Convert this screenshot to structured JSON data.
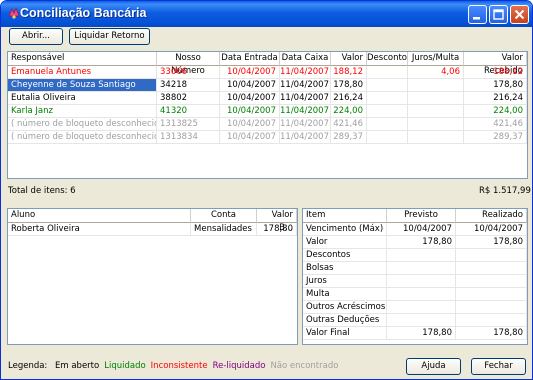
{
  "window": {
    "title": "Conciliação Bancária",
    "controls": [
      "minimize",
      "maximize",
      "close"
    ]
  },
  "toolbar": {
    "open_label": "Abrir...",
    "settle_label": "Liquidar Retorno"
  },
  "main_table": {
    "columns": [
      "Responsável",
      "Nosso Número",
      "Data Entrada",
      "Data Caixa",
      "Valor",
      "Desconto",
      "Juros/Multa",
      "Valor Recebido"
    ],
    "rows": [
      {
        "status": "inconsistente",
        "cells": [
          "Emanuela Antunes",
          "33066",
          "10/04/2007",
          "11/04/2007",
          "188,12",
          "",
          "4,06",
          "188,12"
        ]
      },
      {
        "status": "selected",
        "cells": [
          "Cheyenne de Souza Santiago",
          "34218",
          "10/04/2007",
          "11/04/2007",
          "178,80",
          "",
          "",
          "178,80"
        ]
      },
      {
        "status": "em_aberto",
        "cells": [
          "Eutalia Oliveira",
          "38802",
          "10/04/2007",
          "11/04/2007",
          "216,24",
          "",
          "",
          "216,24"
        ]
      },
      {
        "status": "liquidado",
        "cells": [
          "Karla Janz",
          "41320",
          "10/04/2007",
          "11/04/2007",
          "224,00",
          "",
          "",
          "224,00"
        ]
      },
      {
        "status": "nao_encontrado",
        "cells": [
          "( número de bloqueto desconhecido )",
          "1313825",
          "10/04/2007",
          "11/04/2007",
          "421,46",
          "",
          "",
          "421,46"
        ]
      },
      {
        "status": "nao_encontrado",
        "cells": [
          "( número de bloqueto desconhecido )",
          "1313834",
          "10/04/2007",
          "11/04/2007",
          "289,37",
          "",
          "",
          "289,37"
        ]
      }
    ]
  },
  "totals": {
    "items_label": "Total de itens: 6",
    "amount": "R$ 1.517,99"
  },
  "student_table": {
    "columns": [
      "Aluno",
      "Conta",
      "Valor B..."
    ],
    "rows": [
      [
        "Roberta Oliveira",
        "Mensalidades",
        "178,80"
      ]
    ]
  },
  "detail_table": {
    "columns": [
      "Item",
      "Previsto",
      "Realizado"
    ],
    "rows": [
      [
        "Vencimento (Máx)",
        "10/04/2007",
        "10/04/2007"
      ],
      [
        "Valor",
        "178,80",
        "178,80"
      ],
      [
        "Descontos",
        "",
        ""
      ],
      [
        "Bolsas",
        "",
        ""
      ],
      [
        "Juros",
        "",
        ""
      ],
      [
        "Multa",
        "",
        ""
      ],
      [
        "Outros Acréscimos",
        "",
        ""
      ],
      [
        "Outras Deduções",
        "",
        ""
      ],
      [
        "Valor Final",
        "178,80",
        "178,80"
      ]
    ]
  },
  "legend": {
    "label": "Legenda:",
    "items": [
      {
        "text": "Em aberto",
        "color": "#000000"
      },
      {
        "text": "Liquidado",
        "color": "#008000"
      },
      {
        "text": "Inconsistente",
        "color": "#ff0000"
      },
      {
        "text": "Re-liquidado",
        "color": "#800080"
      },
      {
        "text": "Não encontrado",
        "color": "#a0a0a0"
      }
    ]
  },
  "buttons": {
    "help_label": "Ajuda",
    "close_label": "Fechar"
  },
  "colors": {
    "selection": "#316ac5",
    "title_bar": "#0553d8",
    "inconsistente": "#ff0000",
    "liquidado": "#008000",
    "nao_encontrado": "#a0a0a0"
  }
}
